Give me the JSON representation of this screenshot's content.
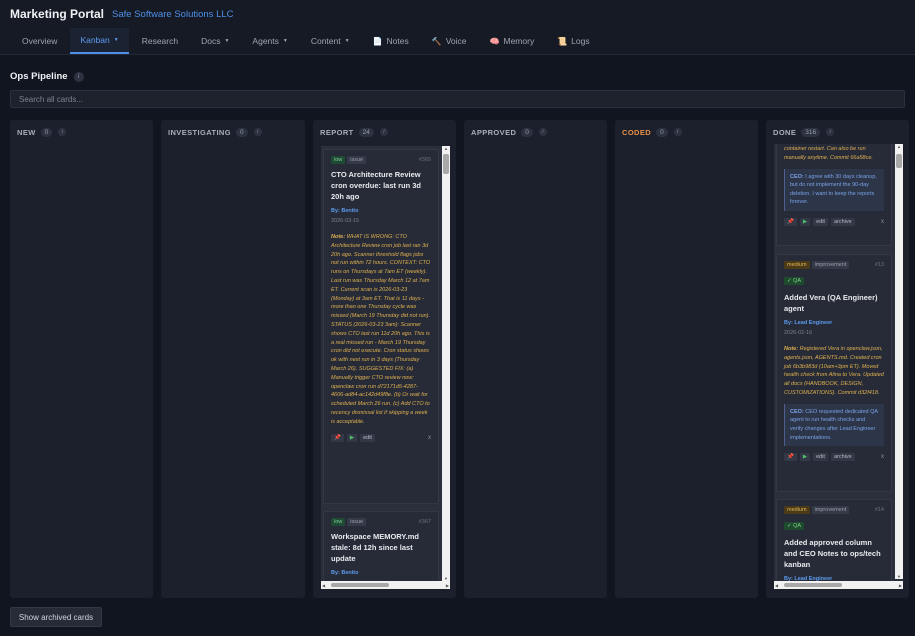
{
  "header": {
    "app_title": "Marketing Portal",
    "org": "Safe Software Solutions LLC"
  },
  "nav": {
    "overview": "Overview",
    "kanban": "Kanban",
    "research": "Research",
    "docs": "Docs",
    "agents": "Agents",
    "content": "Content",
    "notes": "Notes",
    "voice": "Voice",
    "memory": "Memory",
    "logs": "Logs"
  },
  "pipeline": {
    "title": "Ops Pipeline",
    "search_placeholder": "Search all cards..."
  },
  "columns": {
    "new": {
      "name": "NEW",
      "count": "0"
    },
    "investigating": {
      "name": "INVESTIGATING",
      "count": "0"
    },
    "report": {
      "name": "REPORT",
      "count": "24"
    },
    "approved": {
      "name": "APPROVED",
      "count": "0"
    },
    "coded": {
      "name": "CODED",
      "count": "0"
    },
    "done": {
      "name": "DONE",
      "count": "316"
    }
  },
  "report_cards": [
    {
      "priority": "low",
      "type": "issue",
      "id": "#365",
      "title": "CTO Architecture Review cron overdue: last run 3d 20h ago",
      "by": "By: Benito",
      "date": "2026-03-15",
      "note_label": "Note:",
      "note": "WHAT IS WRONG: CTO Architecture Review cron job last ran 3d 20h ago. Scanner threshold flags jobs not run within 72 hours. CONTEXT: CTO runs on Thursdays at 7am ET (weekly). Last run was Thursday March 12 at 7am ET. Current scan is 2026-03-23 (Monday) at 3am ET. That is 11 days - more than one Thursday cycle was missed (March 19 Thursday did not run). STATUS (2026-03-23 3am): Scanner shows CTO last run 11d 20h ago. This is a real missed run - March 19 Thursday cron did not execute. Cron status shows ok with next run in 3 days (Thursday March 26). SUGGESTED FIX: (a) Manually trigger CTO review now: openclaw cron run d72171d5-4287-4606-ad84-ac142d49f8e. (b) Or wait for scheduled March 26 run. (c) Add CTO to recency dismissal list if skipping a week is acceptable.",
      "edit": "edit",
      "close": "x"
    },
    {
      "priority": "low",
      "type": "issue",
      "id": "#367",
      "title": "Workspace MEMORY.md stale: 8d 12h since last update",
      "by": "By: Benito"
    }
  ],
  "done_cards": [
    {
      "note_tail": "container restart. Can also be run manually anytime. Commit 66a58ce.",
      "ceo_label": "CEO:",
      "ceo": "I agree with 30 days cleanup, but do not implement the 90-day deletion. I want to keep the reports forever.",
      "edit": "edit",
      "archive": "archive",
      "close": "x"
    },
    {
      "priority": "medium",
      "type": "improvement",
      "id": "#13",
      "agent": "✓ QA",
      "title": "Added Vera (QA Engineer) agent",
      "by": "By: Lead Engineer",
      "date": "2026-02-16",
      "note_label": "Note:",
      "note": "Registered Vera in openclaw.json, agents.json, AGENTS.md. Created cron job 6b3b983d (10am+3pm ET). Moved health check from Alina to Vera. Updated all docs (HANDBOOK, DESIGN, CUSTOMIZATIONS). Commit d32f418.",
      "ceo_label": "CEO:",
      "ceo": "CEO requested dedicated QA agent to run health checks and verify changes after Lead Engineer implementations.",
      "edit": "edit",
      "archive": "archive",
      "close": "x"
    },
    {
      "priority": "medium",
      "type": "improvement",
      "id": "#14",
      "agent": "✓ QA",
      "title": "Added approved column and CEO Notes to ops/tech kanban",
      "by": "By: Lead Engineer"
    }
  ],
  "footer": {
    "show_archived": "Show archived cards"
  }
}
